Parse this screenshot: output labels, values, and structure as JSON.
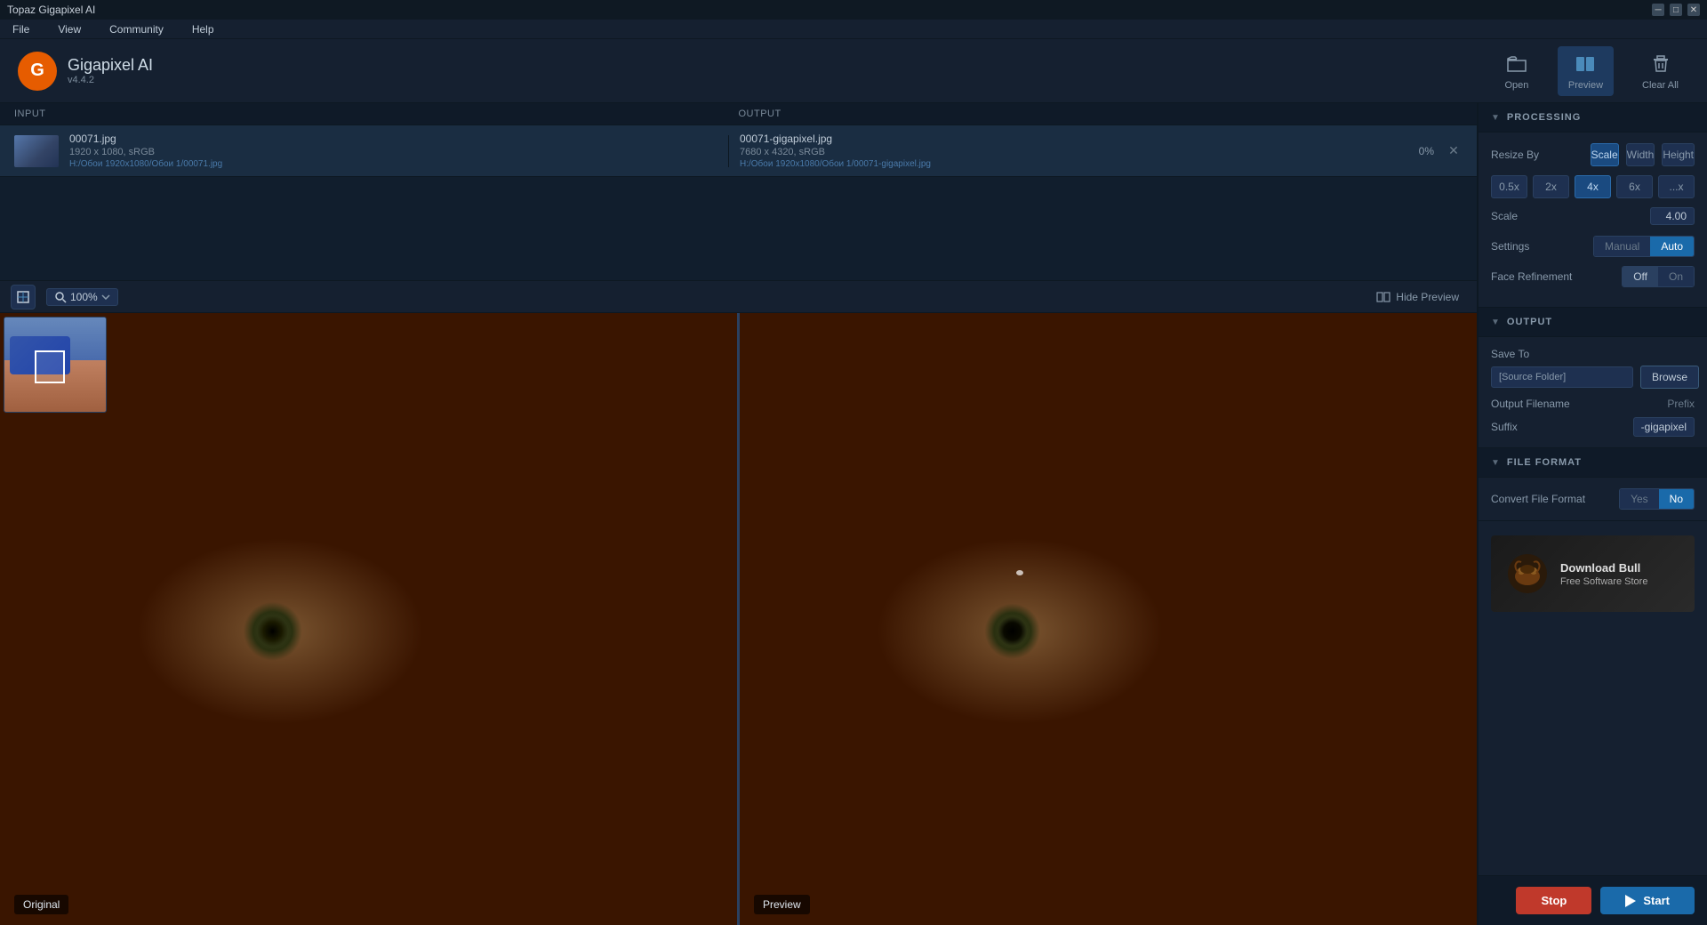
{
  "app": {
    "title": "Topaz Gigapixel AI",
    "name": "Gigapixel AI",
    "version": "v4.4.2"
  },
  "titlebar": {
    "title": "Topaz Gigapixel AI",
    "minimize": "─",
    "maximize": "□",
    "close": "✕"
  },
  "menubar": {
    "items": [
      "File",
      "View",
      "Community",
      "Help"
    ]
  },
  "toolbar": {
    "open_label": "Open",
    "preview_label": "Preview",
    "clear_all_label": "Clear All"
  },
  "file_list": {
    "input_header": "INPUT",
    "output_header": "OUTPUT",
    "file": {
      "name": "00071.jpg",
      "dims": "1920 x 1080, sRGB",
      "path": "H:/Обои 1920x1080/Обои 1/00071.jpg",
      "output_name": "00071-gigapixel.jpg",
      "output_dims": "7680 x 4320, sRGB",
      "output_path": "H:/Обои 1920x1080/Обои 1/00071-gigapixel.jpg",
      "progress": "0%"
    }
  },
  "preview": {
    "zoom": "100%",
    "hide_preview_label": "Hide Preview",
    "original_label": "Original",
    "preview_label": "Preview"
  },
  "processing": {
    "section_title": "PROCESSING",
    "resize_by_label": "Resize By",
    "resize_options": [
      "Scale",
      "Width",
      "Height"
    ],
    "scale_buttons": [
      "0.5x",
      "2x",
      "4x",
      "6x",
      "...x"
    ],
    "scale_label": "Scale",
    "scale_value": "4.00",
    "settings_label": "Settings",
    "settings_manual": "Manual",
    "settings_auto": "Auto",
    "face_refinement_label": "Face Refinement",
    "face_off": "Off",
    "face_on": "On"
  },
  "output": {
    "section_title": "OUTPUT",
    "save_to_label": "Save To",
    "save_to_placeholder": "[Source Folder]",
    "browse_label": "Browse",
    "output_filename_label": "Output Filename",
    "prefix_label": "Prefix",
    "suffix_label": "Suffix",
    "suffix_value": "-gigapixel"
  },
  "file_format": {
    "section_title": "FILE FORMAT",
    "convert_label": "Convert File Format",
    "yes_label": "Yes",
    "no_label": "No"
  },
  "ad": {
    "logo_text": "🐂",
    "title": "Download Bull",
    "subtitle": "Free Software Store"
  },
  "bottom": {
    "stop_label": "Stop",
    "start_label": "Start"
  }
}
